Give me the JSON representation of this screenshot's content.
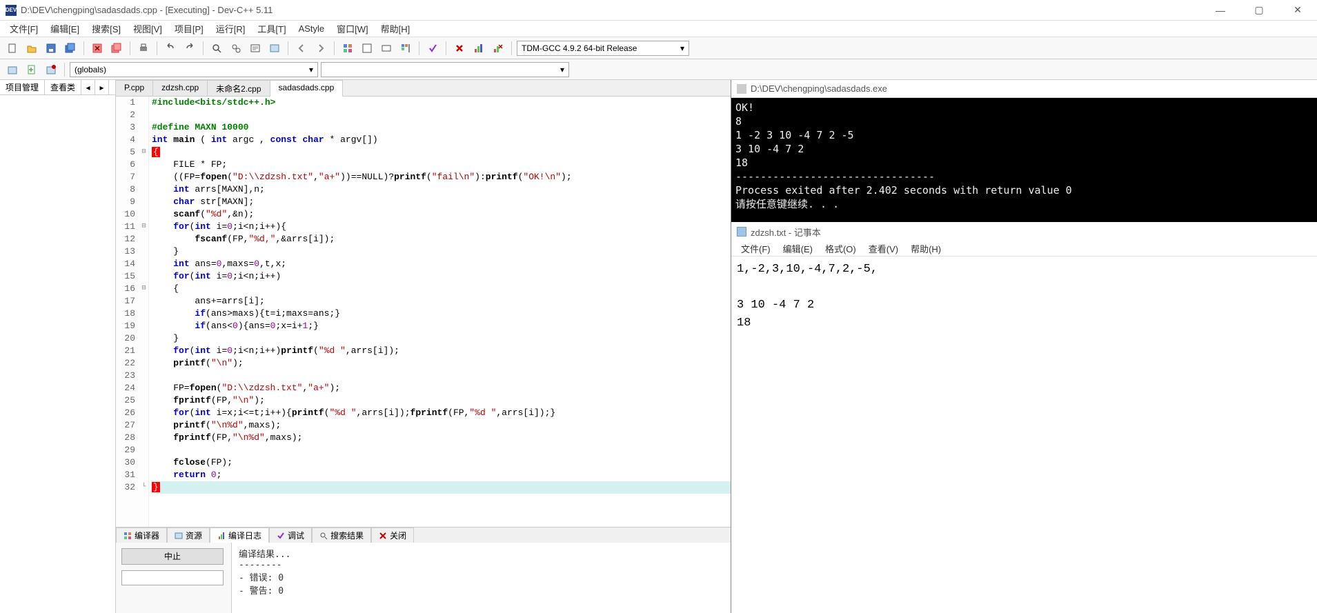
{
  "window": {
    "title": "D:\\DEV\\chengping\\sadasdads.cpp - [Executing] - Dev-C++ 5.11",
    "minimize": "—",
    "maximize": "▢",
    "close": "✕"
  },
  "menubar": [
    "文件[F]",
    "编辑[E]",
    "搜索[S]",
    "视图[V]",
    "项目[P]",
    "运行[R]",
    "工具[T]",
    "AStyle",
    "窗口[W]",
    "帮助[H]"
  ],
  "compiler_combo": "TDM-GCC 4.9.2 64-bit Release",
  "scope_combo": "(globals)",
  "left_tabs": {
    "proj": "项目管理",
    "classes": "查看类"
  },
  "file_tabs": [
    "P.cpp",
    "zdzsh.cpp",
    "未命名2.cpp",
    "sadasdads.cpp"
  ],
  "active_file_tab": 3,
  "code_lines": [
    {
      "n": 1,
      "fold": "",
      "html": "<span class='pp'>#include&lt;bits/stdc++.h&gt;</span>"
    },
    {
      "n": 2,
      "fold": "",
      "html": ""
    },
    {
      "n": 3,
      "fold": "",
      "html": "<span class='pp'>#define MAXN 10000</span>"
    },
    {
      "n": 4,
      "fold": "",
      "html": "<span class='kw'>int</span> <span class='fn'>main</span> ( <span class='kw'>int</span> argc , <span class='kw'>const</span> <span class='kw'>char</span> * argv[])"
    },
    {
      "n": 5,
      "fold": "⊟",
      "html": "<span class='brace'>{</span>"
    },
    {
      "n": 6,
      "fold": "",
      "html": "    FILE * FP;"
    },
    {
      "n": 7,
      "fold": "",
      "html": "    ((FP=<span class='fn'>fopen</span>(<span class='str'>\"D:\\\\zdzsh.txt\"</span>,<span class='str'>\"a+\"</span>))==NULL)?<span class='fn'>printf</span>(<span class='str'>\"fail\\n\"</span>):<span class='fn'>printf</span>(<span class='str'>\"OK!\\n\"</span>);"
    },
    {
      "n": 8,
      "fold": "",
      "html": "    <span class='kw'>int</span> arrs[MAXN],n;"
    },
    {
      "n": 9,
      "fold": "",
      "html": "    <span class='kw'>char</span> str[MAXN];"
    },
    {
      "n": 10,
      "fold": "",
      "html": "    <span class='fn'>scanf</span>(<span class='str'>\"%d\"</span>,&amp;n);"
    },
    {
      "n": 11,
      "fold": "⊟",
      "html": "    <span class='kw'>for</span>(<span class='kw'>int</span> i=<span class='num'>0</span>;i&lt;n;i++){"
    },
    {
      "n": 12,
      "fold": "",
      "html": "        <span class='fn'>fscanf</span>(FP,<span class='str'>\"%d,\"</span>,&amp;arrs[i]);"
    },
    {
      "n": 13,
      "fold": "",
      "html": "    }"
    },
    {
      "n": 14,
      "fold": "",
      "html": "    <span class='kw'>int</span> ans=<span class='num'>0</span>,maxs=<span class='num'>0</span>,t,x;"
    },
    {
      "n": 15,
      "fold": "",
      "html": "    <span class='kw'>for</span>(<span class='kw'>int</span> i=<span class='num'>0</span>;i&lt;n;i++)"
    },
    {
      "n": 16,
      "fold": "⊟",
      "html": "    {"
    },
    {
      "n": 17,
      "fold": "",
      "html": "        ans+=arrs[i];"
    },
    {
      "n": 18,
      "fold": "",
      "html": "        <span class='kw'>if</span>(ans&gt;maxs){t=i;maxs=ans;}"
    },
    {
      "n": 19,
      "fold": "",
      "html": "        <span class='kw'>if</span>(ans&lt;<span class='num'>0</span>){ans=<span class='num'>0</span>;x=i+<span class='num'>1</span>;}"
    },
    {
      "n": 20,
      "fold": "",
      "html": "    }"
    },
    {
      "n": 21,
      "fold": "",
      "html": "    <span class='kw'>for</span>(<span class='kw'>int</span> i=<span class='num'>0</span>;i&lt;n;i++)<span class='fn'>printf</span>(<span class='str'>\"%d \"</span>,arrs[i]);"
    },
    {
      "n": 22,
      "fold": "",
      "html": "    <span class='fn'>printf</span>(<span class='str'>\"\\n\"</span>);"
    },
    {
      "n": 23,
      "fold": "",
      "html": ""
    },
    {
      "n": 24,
      "fold": "",
      "html": "    FP=<span class='fn'>fopen</span>(<span class='str'>\"D:\\\\zdzsh.txt\"</span>,<span class='str'>\"a+\"</span>);"
    },
    {
      "n": 25,
      "fold": "",
      "html": "    <span class='fn'>fprintf</span>(FP,<span class='str'>\"\\n\"</span>);"
    },
    {
      "n": 26,
      "fold": "",
      "html": "    <span class='kw'>for</span>(<span class='kw'>int</span> i=x;i&lt;=t;i++){<span class='fn'>printf</span>(<span class='str'>\"%d \"</span>,arrs[i]);<span class='fn'>fprintf</span>(FP,<span class='str'>\"%d \"</span>,arrs[i]);}"
    },
    {
      "n": 27,
      "fold": "",
      "html": "    <span class='fn'>printf</span>(<span class='str'>\"\\n%d\"</span>,maxs);"
    },
    {
      "n": 28,
      "fold": "",
      "html": "    <span class='fn'>fprintf</span>(FP,<span class='str'>\"\\n%d\"</span>,maxs);"
    },
    {
      "n": 29,
      "fold": "",
      "html": ""
    },
    {
      "n": 30,
      "fold": "",
      "html": "    <span class='fn'>fclose</span>(FP);"
    },
    {
      "n": 31,
      "fold": "",
      "html": "    <span class='kw'>return</span> <span class='num'>0</span>;"
    },
    {
      "n": 32,
      "fold": "└",
      "html": "<span class='brace'>}</span>",
      "hl": true
    }
  ],
  "console": {
    "title": "D:\\DEV\\chengping\\sadasdads.exe",
    "lines": "OK!\n8\n1 -2 3 10 -4 7 2 -5\n3 10 -4 7 2\n18\n--------------------------------\nProcess exited after 2.402 seconds with return value 0\n请按任意键继续. . ."
  },
  "notepad": {
    "title": "zdzsh.txt - 记事本",
    "menu": [
      "文件(F)",
      "编辑(E)",
      "格式(O)",
      "查看(V)",
      "帮助(H)"
    ],
    "content": "1,-2,3,10,-4,7,2,-5,\n\n3 10 -4 7 2\n18"
  },
  "bottom_tabs": [
    {
      "icon": "grid",
      "label": "编译器"
    },
    {
      "icon": "res",
      "label": "资源"
    },
    {
      "icon": "log",
      "label": "编译日志"
    },
    {
      "icon": "check",
      "label": "调试"
    },
    {
      "icon": "search",
      "label": "搜索结果"
    },
    {
      "icon": "close",
      "label": "关闭"
    }
  ],
  "active_bottom_tab": 2,
  "abort_label": "中止",
  "compile_log": "编译结果...\n--------\n- 错误: 0\n- 警告: 0"
}
